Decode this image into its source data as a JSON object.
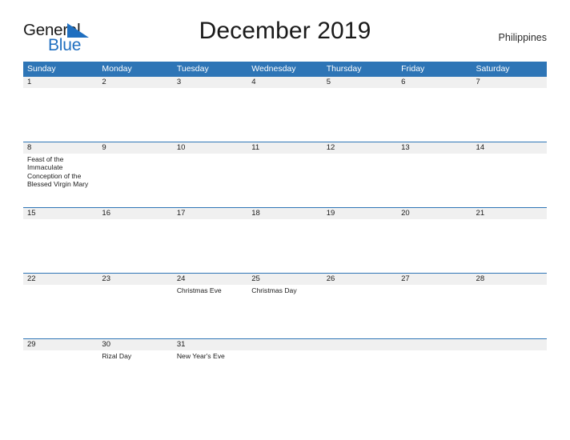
{
  "brand": {
    "name_part1": "General",
    "name_part2": "Blue",
    "flag_icon": "blue-flag-triangle",
    "color_dark": "#1a1a1a",
    "color_blue": "#1f6fc0"
  },
  "header": {
    "title": "December 2019",
    "country": "Philippines"
  },
  "theme": {
    "header_blue": "#2e75b6",
    "date_strip_gray": "#f0f0f0",
    "rule_blue": "#2e75b6",
    "text": "#1a1a1a"
  },
  "calendar": {
    "weekday_headers": [
      "Sunday",
      "Monday",
      "Tuesday",
      "Wednesday",
      "Thursday",
      "Friday",
      "Saturday"
    ],
    "weeks": [
      {
        "dates": [
          "1",
          "2",
          "3",
          "4",
          "5",
          "6",
          "7"
        ],
        "events": [
          "",
          "",
          "",
          "",
          "",
          "",
          ""
        ]
      },
      {
        "dates": [
          "8",
          "9",
          "10",
          "11",
          "12",
          "13",
          "14"
        ],
        "events": [
          "Feast of the Immaculate Conception of the Blessed Virgin Mary",
          "",
          "",
          "",
          "",
          "",
          ""
        ]
      },
      {
        "dates": [
          "15",
          "16",
          "17",
          "18",
          "19",
          "20",
          "21"
        ],
        "events": [
          "",
          "",
          "",
          "",
          "",
          "",
          ""
        ]
      },
      {
        "dates": [
          "22",
          "23",
          "24",
          "25",
          "26",
          "27",
          "28"
        ],
        "events": [
          "",
          "",
          "Christmas Eve",
          "Christmas Day",
          "",
          "",
          ""
        ]
      },
      {
        "dates": [
          "29",
          "30",
          "31",
          "",
          "",
          "",
          ""
        ],
        "events": [
          "",
          "Rizal Day",
          "New Year's Eve",
          "",
          "",
          "",
          ""
        ]
      }
    ]
  }
}
